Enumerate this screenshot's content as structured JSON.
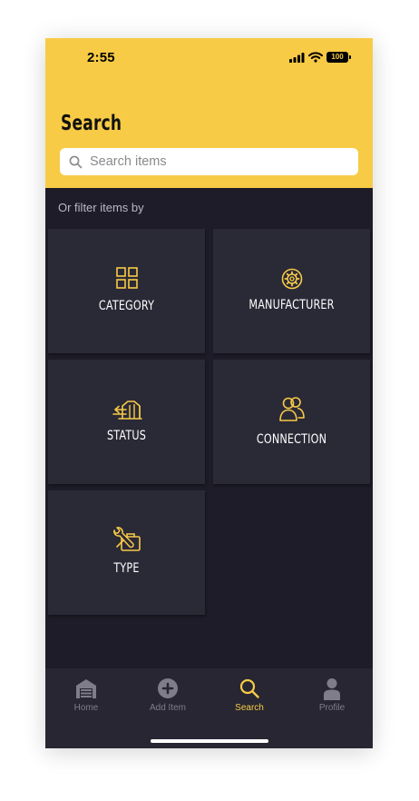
{
  "status_bar": {
    "time": "2:55",
    "battery": "100"
  },
  "header": {
    "title": "Search",
    "background_color": "#f8cb46"
  },
  "search": {
    "placeholder": "Search items",
    "value": ""
  },
  "filter": {
    "label": "Or filter items by",
    "tiles": [
      {
        "label": "CATEGORY",
        "icon": "grid-icon"
      },
      {
        "label": "MANUFACTURER",
        "icon": "gear-icon"
      },
      {
        "label": "STATUS",
        "icon": "status-stack-icon"
      },
      {
        "label": "CONNECTION",
        "icon": "people-icon"
      },
      {
        "label": "TYPE",
        "icon": "tools-icon"
      }
    ]
  },
  "tabbar": {
    "items": [
      {
        "label": "Home",
        "icon": "garage-icon",
        "active": false
      },
      {
        "label": "Add Item",
        "icon": "add-circle-icon",
        "active": false
      },
      {
        "label": "Search",
        "icon": "search-icon",
        "active": true
      },
      {
        "label": "Profile",
        "icon": "profile-icon",
        "active": false
      }
    ]
  },
  "colors": {
    "accent": "#f8cb46",
    "background": "#1e1c28",
    "tile": "#2a2936",
    "tabbar": "#272632",
    "inactive": "#7f7d89"
  }
}
